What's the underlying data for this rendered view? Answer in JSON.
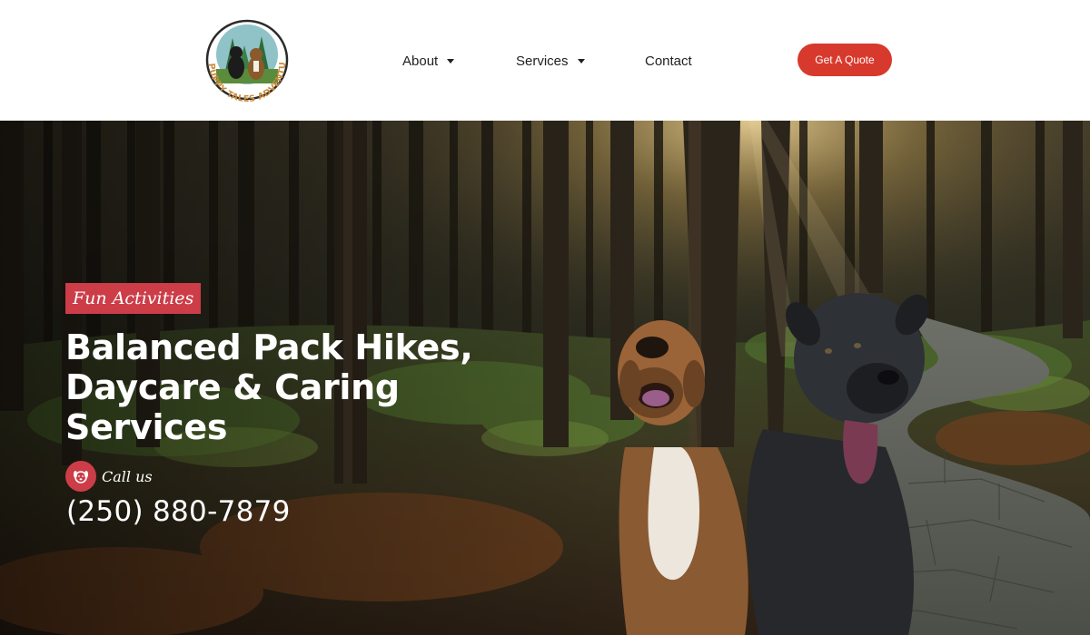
{
  "brand": {
    "logo_text": "PUPPY TALES ADVENTURES"
  },
  "nav": {
    "items": [
      {
        "label": "About",
        "has_dropdown": true
      },
      {
        "label": "Services",
        "has_dropdown": true
      },
      {
        "label": "Contact",
        "has_dropdown": false
      }
    ],
    "cta_label": "Get A Quote"
  },
  "hero": {
    "badge": "Fun Activities",
    "headline": "Balanced Pack Hikes, Daycare & Caring Services",
    "call_label": "Call us",
    "phone": "(250) 880-7879"
  },
  "colors": {
    "accent": "#d8392d",
    "badge": "#cc3d48",
    "text_dark": "#1f1f1f",
    "header_bg": "#ffffff"
  },
  "icons": {
    "dropdown": "chevron-down-icon",
    "call": "dog-face-icon"
  }
}
